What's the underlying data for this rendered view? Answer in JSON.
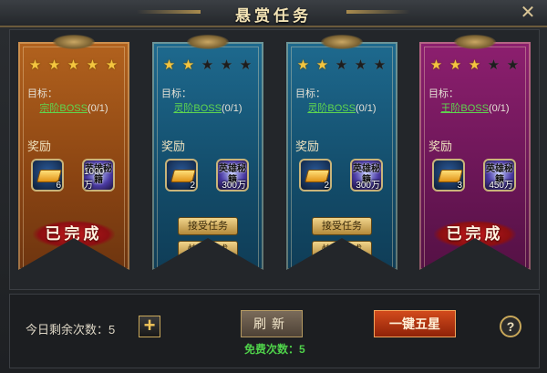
{
  "window": {
    "title": "悬赏任务",
    "close_icon": "close-icon"
  },
  "quests": [
    {
      "color": "#9a4f17",
      "stars": 5,
      "max_stars": 5,
      "target_label": "目标：",
      "boss": "宗阶BOSS",
      "progress": "(0/1)",
      "reward_label": "奖励",
      "items": [
        {
          "icon": "gold-bar-icon",
          "count": "6"
        },
        {
          "icon": "skill-book-icon",
          "text": "英雄秘籍",
          "count": "1000万"
        }
      ],
      "status": "已完成"
    },
    {
      "color": "#16577a",
      "stars": 2,
      "max_stars": 5,
      "target_label": "目标：",
      "boss": "灵阶BOSS",
      "progress": "(0/1)",
      "reward_label": "奖励",
      "items": [
        {
          "icon": "gold-bar-icon",
          "count": "2"
        },
        {
          "icon": "skill-book-icon",
          "text": "英雄秘籍",
          "count": "300万"
        }
      ],
      "buttons": [
        "接受任务",
        "快速完成"
      ]
    },
    {
      "color": "#16577a",
      "stars": 2,
      "max_stars": 5,
      "target_label": "目标：",
      "boss": "灵阶BOSS",
      "progress": "(0/1)",
      "reward_label": "奖励",
      "items": [
        {
          "icon": "gold-bar-icon",
          "count": "2"
        },
        {
          "icon": "skill-book-icon",
          "text": "英雄秘籍",
          "count": "300万"
        }
      ],
      "buttons": [
        "接受任务",
        "快速完成"
      ]
    },
    {
      "color": "#7a1a63",
      "stars": 3,
      "max_stars": 5,
      "target_label": "目标：",
      "boss": "王阶BOSS",
      "progress": "(0/1)",
      "reward_label": "奖励",
      "items": [
        {
          "icon": "gold-bar-icon",
          "count": "3"
        },
        {
          "icon": "skill-book-icon",
          "text": "英雄秘籍",
          "count": "450万"
        }
      ],
      "status": "已完成"
    }
  ],
  "footer": {
    "remaining_label": "今日剩余次数：5",
    "plus": "+",
    "refresh": "刷新",
    "free_label": "免费次数：5",
    "five_star": "一键五星",
    "help": "?"
  }
}
